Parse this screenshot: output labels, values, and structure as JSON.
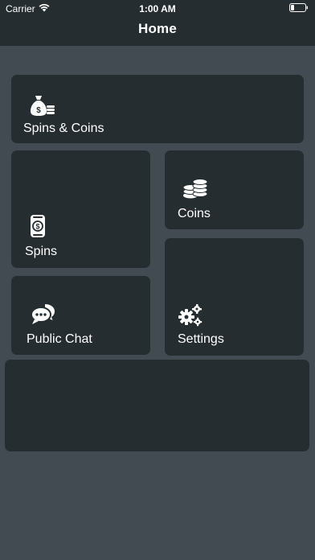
{
  "status_bar": {
    "carrier": "Carrier",
    "time": "1:00 AM"
  },
  "nav": {
    "title": "Home"
  },
  "tiles": {
    "spins_coins": {
      "label": "Spins & Coins",
      "icon": "money-bag-icon"
    },
    "coins": {
      "label": "Coins",
      "icon": "coin-stack-icon"
    },
    "spins": {
      "label": "Spins",
      "icon": "spin-can-icon"
    },
    "public_chat": {
      "label": "Public Chat",
      "icon": "chat-bubbles-icon"
    },
    "settings": {
      "label": "Settings",
      "icon": "gears-icon"
    }
  },
  "colors": {
    "background": "#414b51",
    "tile": "#252d31",
    "header": "#252d31",
    "text": "#ffffff"
  }
}
